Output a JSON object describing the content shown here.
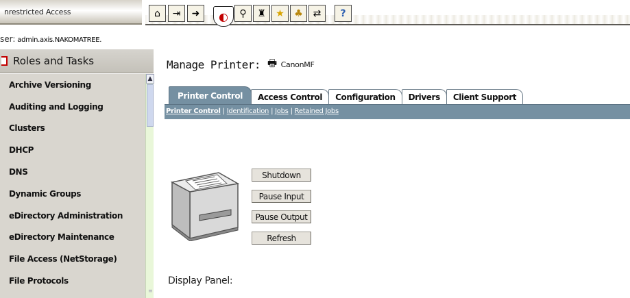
{
  "topbar": {
    "access_label": "nrestricted Access",
    "toolbar_icons": [
      {
        "name": "home-icon",
        "glyph": "⌂"
      },
      {
        "name": "exit-icon",
        "glyph": "⇥"
      },
      {
        "name": "users-arrow-icon",
        "glyph": "➜"
      },
      {
        "name": "roles-tasks-icon",
        "glyph": "◐"
      },
      {
        "name": "search-icon",
        "glyph": "⚲"
      },
      {
        "name": "briefcase-icon",
        "glyph": "♜"
      },
      {
        "name": "favorites-star-icon",
        "glyph": "★"
      },
      {
        "name": "configure-icon",
        "glyph": "♣"
      },
      {
        "name": "network-icon",
        "glyph": "⇄"
      },
      {
        "name": "help-icon",
        "glyph": "?"
      }
    ]
  },
  "user": {
    "label": "ser:",
    "name": "admin.axis.NAKOMATREE."
  },
  "sidebar": {
    "header": "Roles and Tasks",
    "items": [
      {
        "label": "Archive Versioning"
      },
      {
        "label": "Auditing and Logging"
      },
      {
        "label": "Clusters"
      },
      {
        "label": "DHCP"
      },
      {
        "label": "DNS"
      },
      {
        "label": "Dynamic Groups"
      },
      {
        "label": "eDirectory Administration"
      },
      {
        "label": "eDirectory Maintenance"
      },
      {
        "label": "File Access (NetStorage)"
      },
      {
        "label": "File Protocols"
      }
    ]
  },
  "main": {
    "title": "Manage Printer:",
    "printer_name": "CanonMF",
    "tabs": [
      {
        "label": "Printer Control"
      },
      {
        "label": "Access Control"
      },
      {
        "label": "Configuration"
      },
      {
        "label": "Drivers"
      },
      {
        "label": "Client Support"
      }
    ],
    "subnav": [
      {
        "label": "Printer Control"
      },
      {
        "label": "Identification"
      },
      {
        "label": "Jobs"
      },
      {
        "label": "Retained Jobs"
      }
    ],
    "subnav_separator": "|",
    "buttons": {
      "shutdown": "Shutdown",
      "pause_input": "Pause Input",
      "pause_output": "Pause Output",
      "refresh": "Refresh"
    },
    "display_panel_label": "Display Panel:"
  },
  "colors": {
    "tab_accent": "#7590a2",
    "sidebar_bg": "#d9d6cf",
    "scrollbar_bg": "#e9f7d9"
  }
}
